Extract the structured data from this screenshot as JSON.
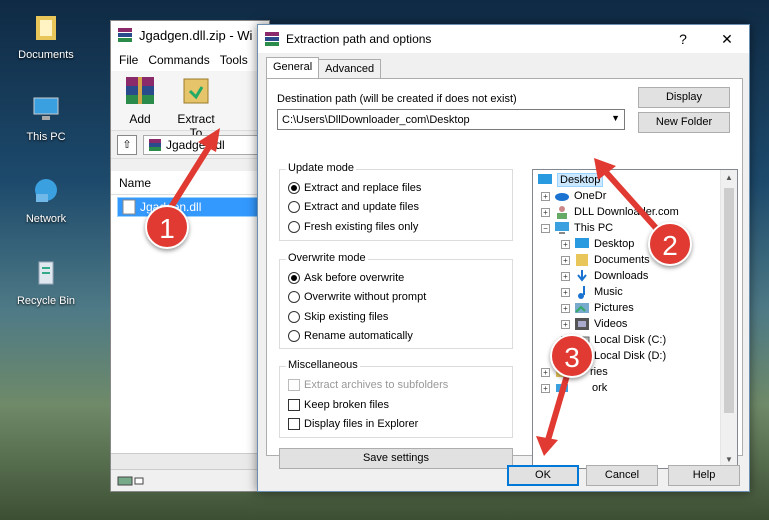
{
  "desktop": {
    "icons": [
      {
        "label": "Documents"
      },
      {
        "label": "This PC"
      },
      {
        "label": "Network"
      },
      {
        "label": "Recycle Bin"
      }
    ]
  },
  "winrar": {
    "title": "Jgadgen.dll.zip - Wi",
    "menu": [
      "File",
      "Commands",
      "Tools"
    ],
    "toolbar": {
      "add": "Add",
      "extract_to": "Extract To"
    },
    "address": "Jgadgen.dl",
    "column_name": "Name",
    "file": "Jgadgen.dll"
  },
  "dialog": {
    "title": "Extraction path and options",
    "help": "?",
    "close": "✕",
    "tabs": [
      "General",
      "Advanced"
    ],
    "dest_label": "Destination path (will be created if does not exist)",
    "dest_value": "C:\\Users\\DllDownloader_com\\Desktop",
    "btn_display": "Display",
    "btn_new_folder": "New Folder",
    "update_mode": {
      "title": "Update mode",
      "options": [
        "Extract and replace files",
        "Extract and update files",
        "Fresh existing files only"
      ]
    },
    "overwrite_mode": {
      "title": "Overwrite mode",
      "options": [
        "Ask before overwrite",
        "Overwrite without prompt",
        "Skip existing files",
        "Rename automatically"
      ]
    },
    "misc": {
      "title": "Miscellaneous",
      "options": [
        "Extract archives to subfolders",
        "Keep broken files",
        "Display files in Explorer"
      ]
    },
    "save_settings": "Save settings",
    "tree": {
      "desktop": "Desktop",
      "onedrive": "OneDr",
      "user": "DLL Downloader.com",
      "this_pc": "This PC",
      "desktop2": "Desktop",
      "documents": "Documents",
      "downloads": "Downloads",
      "music": "Music",
      "pictures": "Pictures",
      "videos": "Videos",
      "disk_c": "Local Disk (C:)",
      "disk_d": "Local Disk (D:)",
      "libraries": "ries",
      "network": "ork"
    },
    "ok": "OK",
    "cancel": "Cancel",
    "help_btn": "Help"
  },
  "annotations": [
    "1",
    "2",
    "3"
  ],
  "colors": {
    "accent": "#0078d7",
    "annotation": "#e03a32",
    "selection": "#3399ff"
  }
}
